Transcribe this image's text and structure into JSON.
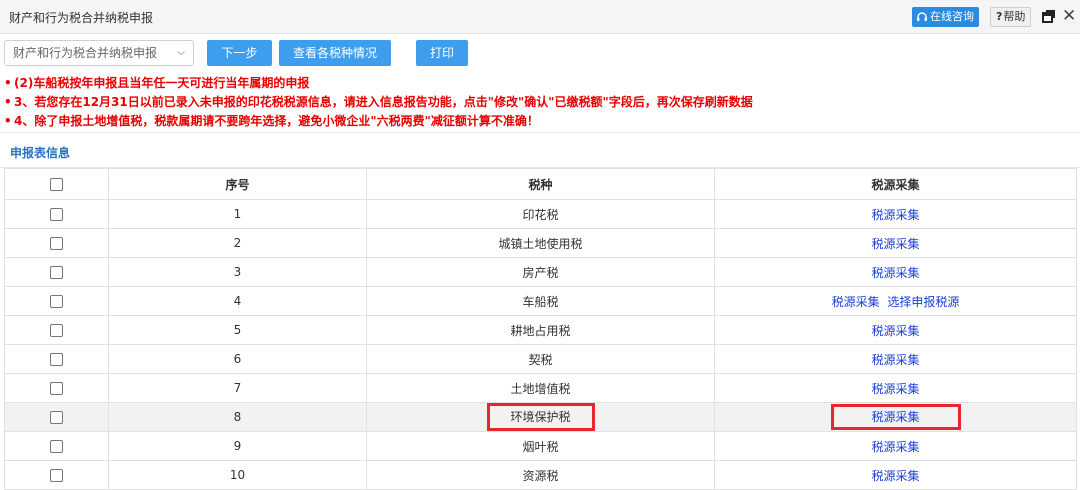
{
  "window": {
    "title": "财产和行为税合并纳税申报",
    "online_consult": "在线咨询",
    "help": "帮助"
  },
  "toolbar": {
    "select_value": "财产和行为税合并纳税申报",
    "next_label": "下一步",
    "view_label": "查看各税种情况",
    "print_label": "打印"
  },
  "notices": [
    "(2)车船税按年申报且当年任一天可进行当年属期的申报",
    "3、若您存在12月31日以前已录入未申报的印花税税源信息，请进入信息报告功能，点击\"修改\"确认\"已缴税额\"字段后，再次保存刷新数据",
    "4、除了申报土地增值税，税款属期请不要跨年选择，避免小微企业\"六税两费\"减征额计算不准确！"
  ],
  "section_title": "申报表信息",
  "table": {
    "headers": [
      "序号",
      "税种",
      "税源采集"
    ],
    "rows": [
      {
        "no": "1",
        "tax": "印花税",
        "link": "税源采集"
      },
      {
        "no": "2",
        "tax": "城镇土地使用税",
        "link": "税源采集"
      },
      {
        "no": "3",
        "tax": "房产税",
        "link": "税源采集"
      },
      {
        "no": "4",
        "tax": "车船税",
        "link": "税源采集",
        "link2": "选择申报税源"
      },
      {
        "no": "5",
        "tax": "耕地占用税",
        "link": "税源采集"
      },
      {
        "no": "6",
        "tax": "契税",
        "link": "税源采集"
      },
      {
        "no": "7",
        "tax": "土地增值税",
        "link": "税源采集"
      },
      {
        "no": "8",
        "tax": "环境保护税",
        "link": "税源采集"
      },
      {
        "no": "9",
        "tax": "烟叶税",
        "link": "税源采集"
      },
      {
        "no": "10",
        "tax": "资源税",
        "link": "税源采集"
      }
    ]
  }
}
